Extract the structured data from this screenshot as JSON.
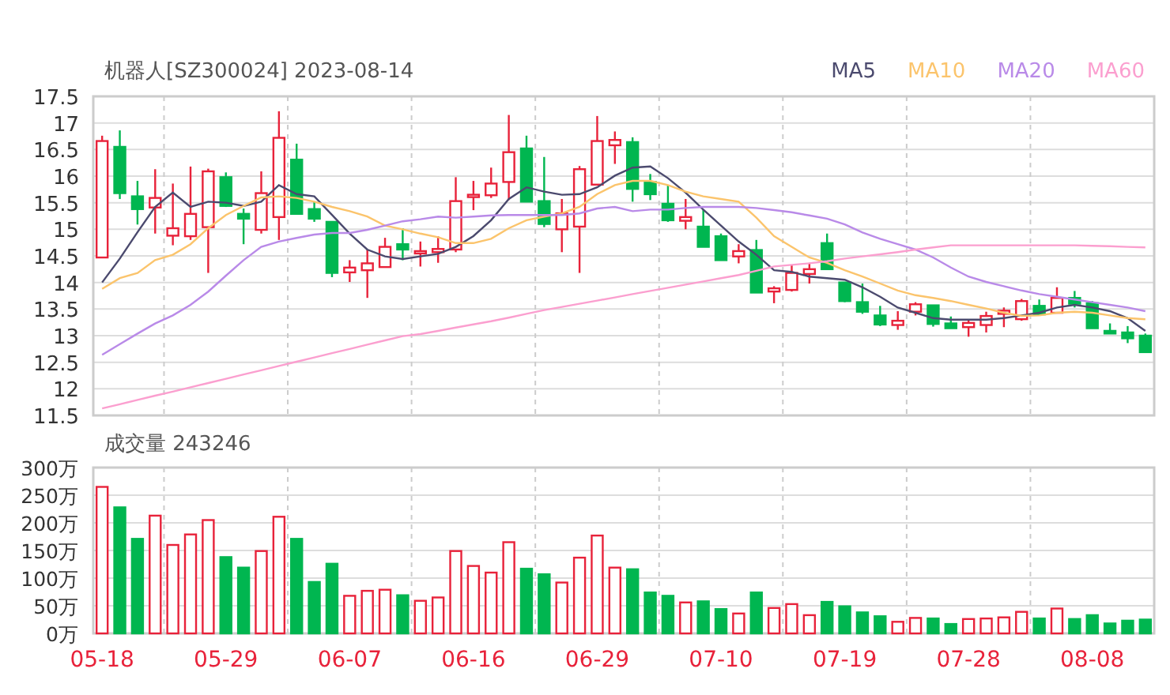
{
  "price_chart": {
    "chart_data": {
      "type": "candlestick",
      "title": "机器人[SZ300024] 2023-08-14",
      "grid": true,
      "ylim": [
        11.5,
        17.5
      ],
      "yticks": [
        11.5,
        12,
        12.5,
        13,
        13.5,
        14,
        14.5,
        15,
        15.5,
        16,
        16.5,
        17,
        17.5
      ],
      "categories": [
        null,
        null,
        null,
        null,
        null,
        null,
        null,
        null,
        null,
        null,
        null,
        null,
        null,
        null,
        null,
        null,
        null,
        null,
        null,
        null,
        null,
        null,
        null,
        null,
        null,
        null,
        null,
        null,
        null,
        null,
        null,
        null,
        null,
        null,
        null,
        null,
        null,
        null,
        null,
        null,
        null,
        null,
        null,
        null,
        null,
        null,
        null,
        null,
        null,
        null,
        null,
        null,
        null,
        null,
        null,
        null,
        null,
        null,
        null,
        null
      ],
      "ohlc": [
        [
          14.47,
          16.76,
          14.47,
          16.66
        ],
        [
          16.55,
          16.86,
          15.57,
          15.68
        ],
        [
          15.62,
          15.91,
          15.09,
          15.38
        ],
        [
          15.41,
          16.13,
          14.92,
          15.59
        ],
        [
          14.88,
          15.86,
          14.7,
          15.02
        ],
        [
          14.87,
          16.18,
          14.8,
          15.29
        ],
        [
          15.04,
          16.14,
          14.18,
          16.09
        ],
        [
          15.98,
          16.07,
          15.42,
          15.44
        ],
        [
          15.29,
          15.39,
          14.72,
          15.2
        ],
        [
          14.99,
          16.09,
          14.92,
          15.68
        ],
        [
          15.23,
          17.22,
          14.8,
          16.72
        ],
        [
          16.31,
          16.61,
          15.29,
          15.29
        ],
        [
          15.38,
          15.52,
          15.14,
          15.2
        ],
        [
          15.14,
          15.14,
          14.1,
          14.18
        ],
        [
          14.19,
          14.42,
          14.01,
          14.28
        ],
        [
          14.23,
          14.62,
          13.71,
          14.36
        ],
        [
          14.29,
          14.84,
          14.29,
          14.67
        ],
        [
          14.72,
          15.02,
          14.42,
          14.62
        ],
        [
          14.55,
          14.77,
          14.3,
          14.59
        ],
        [
          14.57,
          14.87,
          14.37,
          14.63
        ],
        [
          14.62,
          15.98,
          14.57,
          15.53
        ],
        [
          15.63,
          15.91,
          15.36,
          15.65
        ],
        [
          15.64,
          16.16,
          15.59,
          15.86
        ],
        [
          15.89,
          17.15,
          15.55,
          16.45
        ],
        [
          16.52,
          16.76,
          15.52,
          15.52
        ],
        [
          15.53,
          16.36,
          15.04,
          15.1
        ],
        [
          15.0,
          15.57,
          14.57,
          15.3
        ],
        [
          15.05,
          16.19,
          14.18,
          16.13
        ],
        [
          15.84,
          17.13,
          15.84,
          16.66
        ],
        [
          16.58,
          16.84,
          16.23,
          16.68
        ],
        [
          16.64,
          16.73,
          15.52,
          15.76
        ],
        [
          15.89,
          16.04,
          15.55,
          15.66
        ],
        [
          15.48,
          15.83,
          15.14,
          15.17
        ],
        [
          15.16,
          15.57,
          15.0,
          15.23
        ],
        [
          15.05,
          15.37,
          14.67,
          14.67
        ],
        [
          14.87,
          14.92,
          14.42,
          14.42
        ],
        [
          14.49,
          14.72,
          14.36,
          14.59
        ],
        [
          14.61,
          14.8,
          13.81,
          13.81
        ],
        [
          13.83,
          13.93,
          13.61,
          13.89
        ],
        [
          13.86,
          14.33,
          13.83,
          14.18
        ],
        [
          14.16,
          14.37,
          13.98,
          14.25
        ],
        [
          14.74,
          14.92,
          14.25,
          14.25
        ],
        [
          14.0,
          14.0,
          13.63,
          13.65
        ],
        [
          13.63,
          13.98,
          13.41,
          13.45
        ],
        [
          13.38,
          13.56,
          13.18,
          13.21
        ],
        [
          13.2,
          13.46,
          13.11,
          13.28
        ],
        [
          13.45,
          13.63,
          13.38,
          13.59
        ],
        [
          13.57,
          13.57,
          13.17,
          13.22
        ],
        [
          13.23,
          13.36,
          13.14,
          13.14
        ],
        [
          13.16,
          13.3,
          12.98,
          13.24
        ],
        [
          13.2,
          13.45,
          13.06,
          13.37
        ],
        [
          13.41,
          13.53,
          13.16,
          13.47
        ],
        [
          13.31,
          13.69,
          13.28,
          13.65
        ],
        [
          13.56,
          13.68,
          13.38,
          13.4
        ],
        [
          13.43,
          13.91,
          13.43,
          13.71
        ],
        [
          13.71,
          13.84,
          13.53,
          13.6
        ],
        [
          13.61,
          13.65,
          13.14,
          13.14
        ],
        [
          13.09,
          13.23,
          13.04,
          13.04
        ],
        [
          13.06,
          13.18,
          12.86,
          12.95
        ],
        [
          13.0,
          13.04,
          12.69,
          12.69
        ]
      ]
    }
  },
  "moving_averages": {
    "chart_data": {
      "type": "line",
      "ylim": [
        11.5,
        17.5
      ],
      "series": [
        {
          "name": "MA5",
          "color": "#4b4a6e",
          "values": [
            14.0,
            14.45,
            14.95,
            15.42,
            15.69,
            15.42,
            15.52,
            15.5,
            15.44,
            15.52,
            15.83,
            15.66,
            15.62,
            15.27,
            14.92,
            14.62,
            14.49,
            14.44,
            14.49,
            14.54,
            14.67,
            14.87,
            15.17,
            15.57,
            15.79,
            15.71,
            15.65,
            15.66,
            15.79,
            16.01,
            16.16,
            16.18,
            15.96,
            15.69,
            15.37,
            15.07,
            14.77,
            14.52,
            14.23,
            14.2,
            14.11,
            14.08,
            14.05,
            13.91,
            13.73,
            13.53,
            13.43,
            13.33,
            13.3,
            13.3,
            13.3,
            13.33,
            13.38,
            13.43,
            13.53,
            13.58,
            13.53,
            13.46,
            13.33,
            13.09
          ]
        },
        {
          "name": "MA10",
          "color": "#fbc46c",
          "values": [
            13.88,
            14.08,
            14.18,
            14.42,
            14.52,
            14.72,
            15.02,
            15.27,
            15.44,
            15.6,
            15.62,
            15.59,
            15.52,
            15.42,
            15.34,
            15.24,
            15.07,
            15.0,
            14.92,
            14.85,
            14.74,
            14.74,
            14.82,
            15.02,
            15.17,
            15.24,
            15.3,
            15.42,
            15.66,
            15.83,
            15.91,
            15.91,
            15.83,
            15.71,
            15.62,
            15.57,
            15.52,
            15.22,
            14.87,
            14.67,
            14.47,
            14.37,
            14.23,
            14.11,
            13.98,
            13.85,
            13.76,
            13.71,
            13.65,
            13.58,
            13.51,
            13.43,
            13.37,
            13.38,
            13.43,
            13.45,
            13.43,
            13.38,
            13.33,
            13.31
          ]
        },
        {
          "name": "MA20",
          "color": "#b98ae8",
          "values": [
            12.64,
            12.84,
            13.04,
            13.23,
            13.38,
            13.58,
            13.83,
            14.13,
            14.42,
            14.67,
            14.77,
            14.84,
            14.9,
            14.93,
            14.93,
            14.99,
            15.07,
            15.15,
            15.19,
            15.24,
            15.22,
            15.24,
            15.26,
            15.27,
            15.27,
            15.27,
            15.27,
            15.3,
            15.39,
            15.42,
            15.34,
            15.37,
            15.37,
            15.4,
            15.42,
            15.42,
            15.42,
            15.4,
            15.36,
            15.32,
            15.26,
            15.2,
            15.09,
            14.94,
            14.82,
            14.72,
            14.62,
            14.47,
            14.28,
            14.11,
            14.01,
            13.93,
            13.85,
            13.78,
            13.73,
            13.68,
            13.63,
            13.58,
            13.53,
            13.46
          ]
        },
        {
          "name": "MA60",
          "color": "#fb9fcf",
          "values": [
            11.63,
            11.71,
            11.79,
            11.87,
            11.95,
            12.03,
            12.11,
            12.19,
            12.27,
            12.35,
            12.43,
            12.51,
            12.59,
            12.67,
            12.75,
            12.83,
            12.91,
            12.99,
            13.03,
            13.09,
            13.15,
            13.21,
            13.27,
            13.34,
            13.41,
            13.48,
            13.54,
            13.6,
            13.66,
            13.72,
            13.78,
            13.84,
            13.9,
            13.96,
            14.02,
            14.08,
            14.14,
            14.22,
            14.3,
            14.33,
            14.36,
            14.4,
            14.45,
            14.49,
            14.53,
            14.57,
            14.62,
            14.66,
            14.7,
            14.7,
            14.7,
            14.7,
            14.7,
            14.7,
            14.7,
            14.7,
            14.69,
            14.68,
            14.67,
            14.66
          ]
        }
      ]
    }
  },
  "volume_chart": {
    "chart_data": {
      "type": "bar",
      "title": "成交量 243246",
      "grid": true,
      "ylim": [
        0,
        300
      ],
      "yticks": [
        {
          "value": 0,
          "label": "0万"
        },
        {
          "value": 50,
          "label": "50万"
        },
        {
          "value": 100,
          "label": "100万"
        },
        {
          "value": 150,
          "label": "150万"
        },
        {
          "value": 200,
          "label": "200万"
        },
        {
          "value": 250,
          "label": "250万"
        },
        {
          "value": 300,
          "label": "300万"
        }
      ],
      "categories": [
        "05-18",
        null,
        null,
        null,
        null,
        null,
        null,
        "05-29",
        null,
        null,
        null,
        null,
        null,
        null,
        "06-07",
        null,
        null,
        null,
        null,
        null,
        null,
        "06-16",
        null,
        null,
        null,
        null,
        null,
        null,
        "06-29",
        null,
        null,
        null,
        null,
        null,
        null,
        "07-10",
        null,
        null,
        null,
        null,
        null,
        null,
        "07-19",
        null,
        null,
        null,
        null,
        null,
        null,
        "07-28",
        null,
        null,
        null,
        null,
        null,
        null,
        "08-08",
        null,
        null,
        null
      ],
      "series": [
        {
          "values": [
            265,
            228,
            171,
            213,
            160,
            179,
            205,
            138,
            119,
            149,
            211,
            171,
            93,
            126,
            68,
            77,
            79,
            69,
            59,
            65,
            149,
            122,
            110,
            165,
            117,
            107,
            92,
            137,
            177,
            119,
            116,
            74,
            68,
            56,
            58,
            44,
            36,
            74,
            46,
            53,
            33,
            57,
            49,
            38,
            31,
            21,
            28,
            27,
            17,
            26,
            27,
            29,
            39,
            27,
            45,
            26,
            33,
            18,
            23,
            25
          ]
        }
      ]
    }
  }
}
